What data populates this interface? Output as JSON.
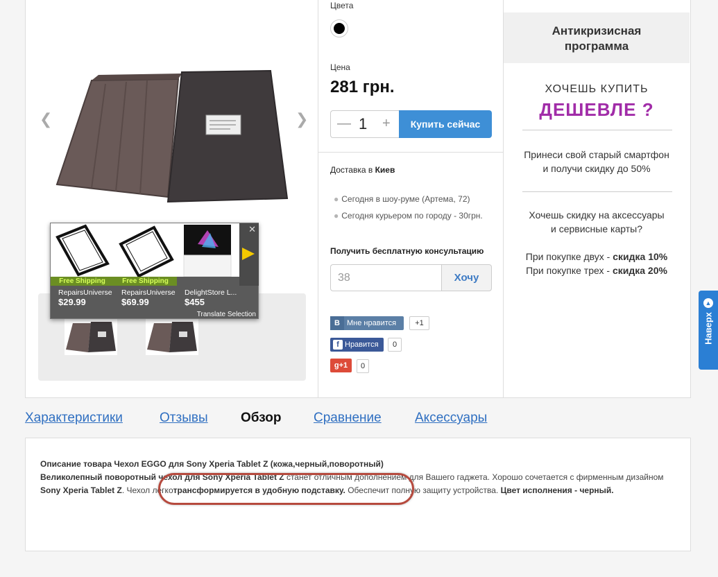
{
  "gallery": {
    "prev_icon": "chevron-left",
    "next_icon": "chevron-right",
    "main_photo_alt": "tablet case",
    "thumbnails": 2
  },
  "ad": {
    "items": [
      {
        "shipping": "Free Shipping",
        "store": "RepairsUniverse",
        "price": "$29.99"
      },
      {
        "shipping": "Free Shipping",
        "store": "RepairsUniverse",
        "price": "$69.99"
      },
      {
        "shipping": "",
        "store": "DelightStore L...",
        "price": "$455"
      }
    ],
    "close": "✕",
    "translate": "Translate Selection"
  },
  "buy": {
    "colors_label": "Цвета",
    "price_label": "Цена",
    "price": "281 грн.",
    "qty_minus": "—",
    "qty": "1",
    "qty_plus": "+",
    "buy_button": "Купить сейчас",
    "delivery_prefix": "Доставка в ",
    "delivery_city": "Киев",
    "delivery_options": [
      "Сегодня в шоу-руме (Артема, 72)",
      "Сегодня курьером по городу - 30грн."
    ],
    "consult_label": "Получить бесплатную консультацию",
    "phone_placeholder": "38",
    "want_button": "Хочу"
  },
  "social": {
    "vk_icon": "В",
    "vk_label": "Мне нравится",
    "vk_count": "+1",
    "fb_icon": "f",
    "fb_label": "Нравится",
    "fb_count": "0",
    "gp_label": "g+1",
    "gp_count": "0"
  },
  "promo": {
    "heading_line1": "Антикризисная",
    "heading_line2": "программа",
    "want": "ХОЧЕШЬ КУПИТЬ",
    "cheaper": "ДЕШЕВЛЕ ?",
    "text1_line1": "Принеси свой старый смартфон",
    "text1_line2": "и получи скидку до 50%",
    "text2_line1": "Хочешь скидку на аксессуары",
    "text2_line2": "и сервисные карты?",
    "text3_line1_prefix": "При покупке двух - ",
    "text3_line1_bold": "скидка 10%",
    "text3_line2_prefix": "При покупке трех - ",
    "text3_line2_bold": "скидка 20%"
  },
  "totop": {
    "label": "Наверх",
    "icon": "chevron-up"
  },
  "tabs": [
    {
      "label": "Характеристики",
      "active": false
    },
    {
      "label": "Отзывы",
      "active": false
    },
    {
      "label": "Обзор",
      "active": true
    },
    {
      "label": "Сравнение",
      "active": false
    },
    {
      "label": "Аксессуары",
      "active": false
    }
  ],
  "description": {
    "title": "Описание товара Чехол EGGO для Sony Xperia Tablet Z (кожа,черный,поворотный)",
    "p1_bold": "Великолепный поворотный чехол для Sony Xperia Tablet Z",
    "p1_text": " станет отличным дополнением для Вашего гаджета. Хорошо сочетается с фирменным дизайном ",
    "p1_bold2": "Sony Xperia Tablet Z",
    "p1_text2": ". Чехол легко",
    "p1_bold3": "трансформируется в удобную подставку.",
    "p1_text3": " Обеспечит полную защиту устройства. ",
    "p1_bold4": "Цвет исполнения - черный."
  },
  "colors": {
    "accent": "#3e8fd6",
    "promo_purple": "#a12ca8",
    "highlight": "#b64a3e"
  }
}
